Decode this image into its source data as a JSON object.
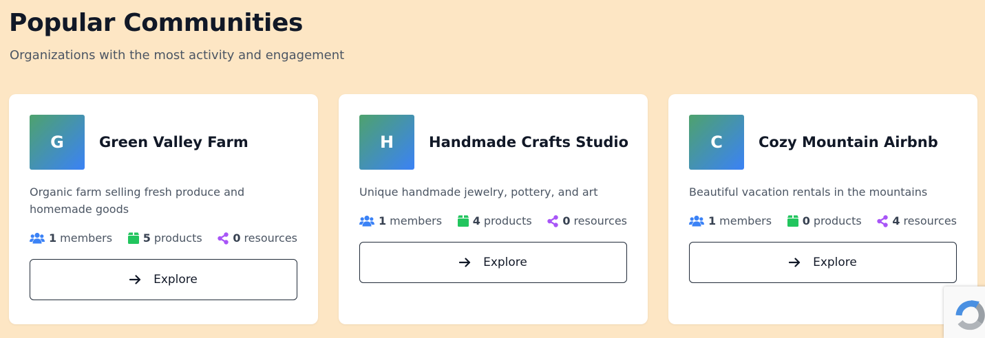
{
  "section": {
    "title": "Popular Communities",
    "subtitle": "Organizations with the most activity and engagement"
  },
  "communities": [
    {
      "initial": "G",
      "name": "Green Valley Farm",
      "description": "Organic farm selling fresh produce and homemade goods",
      "members_count": "1",
      "members_label": "members",
      "products_count": "5",
      "products_label": "products",
      "resources_count": "0",
      "resources_label": "resources",
      "explore_label": "Explore"
    },
    {
      "initial": "H",
      "name": "Handmade Crafts Studio",
      "description": "Unique handmade jewelry, pottery, and art",
      "members_count": "1",
      "members_label": "members",
      "products_count": "4",
      "products_label": "products",
      "resources_count": "0",
      "resources_label": "resources",
      "explore_label": "Explore"
    },
    {
      "initial": "C",
      "name": "Cozy Mountain Airbnb",
      "description": "Beautiful vacation rentals in the mountains",
      "members_count": "1",
      "members_label": "members",
      "products_count": "0",
      "products_label": "products",
      "resources_count": "4",
      "resources_label": "resources",
      "explore_label": "Explore"
    }
  ],
  "colors": {
    "background": "#fde6c4",
    "members_icon": "#3b82f6",
    "products_icon": "#22c55e",
    "resources_icon": "#a855f7",
    "avatar_gradient_start": "#4ea26d",
    "avatar_gradient_end": "#3b82f6"
  },
  "icons": {
    "members": "users-icon",
    "products": "box-icon",
    "resources": "share-icon",
    "explore": "arrow-right-icon",
    "captcha": "recaptcha-icon"
  }
}
